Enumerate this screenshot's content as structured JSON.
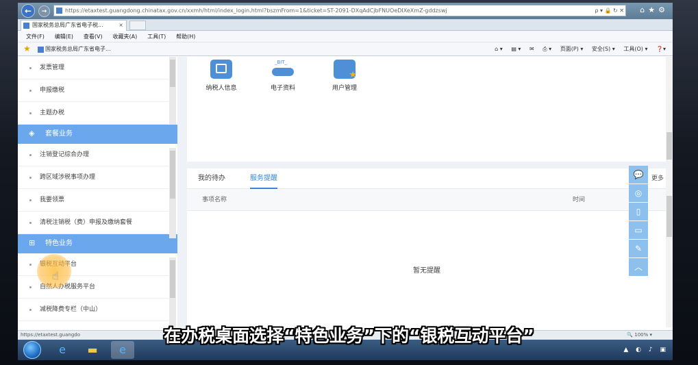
{
  "browser": {
    "url": "https://etaxtest.guangdong.chinatax.gov.cn/xxmh/html/index_login.html?bszmFrom=1&ticket=ST-2091-DXqAdCjbFNUOeDIXeXmZ-gddzswj",
    "url_tools": "ρ ▾ 🔒 ↻ ✕",
    "tab_title": "国家税务总局广东省电子税...",
    "menu": [
      "文件(F)",
      "编辑(E)",
      "查看(V)",
      "收藏夹(A)",
      "工具(T)",
      "帮助(H)"
    ],
    "favorite": "国家税务总局广东省电子...",
    "command_bar": [
      "页面(P) ▾",
      "安全(S) ▾",
      "工具(O) ▾"
    ],
    "status_url": "https://etaxtest.guangdo",
    "zoom": "100%"
  },
  "sidebar": {
    "group1_items": [
      "发票管理",
      "申报缴税",
      "主题办税"
    ],
    "group2_title": "套餐业务",
    "group2_items": [
      "注销登记综合办理",
      "跨区域涉税事项办理",
      "我要领票",
      "清税注销税（费）申报及缴纳套餐"
    ],
    "group3_title": "特色业务",
    "group3_items": [
      "银税互动平台",
      "自然人办税服务平台",
      "减税降费专栏（中山）"
    ]
  },
  "apps": {
    "taxpayer_info": "纳税人信息",
    "electronic_docs": "电子资料",
    "electronic_docs_badge": "_BIT_",
    "user_mgmt": "用户管理"
  },
  "panel": {
    "tab_todo": "我的待办",
    "tab_reminder": "服务提醒",
    "more": "更多",
    "col_item": "事项名称",
    "col_time": "时间",
    "empty": "暂无提醒"
  },
  "subtitle": "在办税桌面选择“特色业务”下的“银税互动平台”",
  "colors": {
    "accent": "#6aa7ec",
    "active_tab": "#3a85d9",
    "float_bar": "#8ec0ee"
  }
}
